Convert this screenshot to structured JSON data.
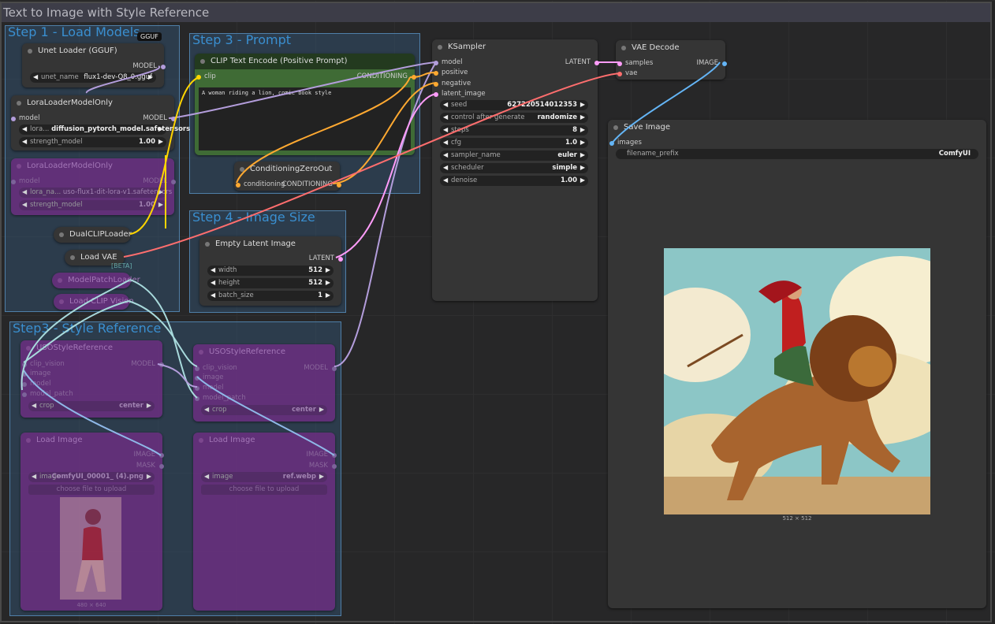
{
  "workflow_title": "Text to Image with Style Reference",
  "groups": {
    "step1": "Step 1 - Load Models",
    "step3_prompt": "Step 3 - Prompt",
    "step4": "Step 4 - Image Size",
    "step3_style": "Step3 - Style Reference"
  },
  "gguf_badge": "GGUF",
  "unet_loader": {
    "title": "Unet Loader (GGUF)",
    "out": "MODEL",
    "widget_label": "unet_name",
    "widget_value": "flux1-dev-Q8_0.gguf"
  },
  "lora_loader": {
    "title": "LoraLoaderModelOnly",
    "in_model": "model",
    "out": "MODEL",
    "lora_label": "lora...",
    "lora_value": "diffusion_pytorch_model.safetensors",
    "strength_label": "strength_model",
    "strength_value": "1.00"
  },
  "lora_loader2": {
    "title": "LoraLoaderModelOnly",
    "in_model": "model",
    "out": "MODEL",
    "lora_label": "lora_na...",
    "lora_value": "uso-flux1-dit-lora-v1.safetensors",
    "strength_label": "strength_model",
    "strength_value": "1.00"
  },
  "dual_clip": {
    "title": "DualCLIPLoader"
  },
  "load_vae": {
    "title": "Load VAE",
    "tag": "[BETA]"
  },
  "model_patch": {
    "title": "ModelPatchLoader"
  },
  "load_clip_vision": {
    "title": "Load CLIP Vision"
  },
  "clip_encode": {
    "title": "CLIP Text Encode (Positive Prompt)",
    "in_clip": "clip",
    "out": "CONDITIONING",
    "text": "A woman riding a lion, comic book style"
  },
  "cond_zero": {
    "title": "ConditioningZeroOut",
    "in": "conditioning",
    "out": "CONDITIONING"
  },
  "empty_latent": {
    "title": "Empty Latent Image",
    "out": "LATENT",
    "width_label": "width",
    "width": "512",
    "height_label": "height",
    "height": "512",
    "batch_label": "batch_size",
    "batch": "1"
  },
  "ksampler": {
    "title": "KSampler",
    "in_model": "model",
    "in_positive": "positive",
    "in_negative": "negative",
    "in_latent": "latent_image",
    "out": "LATENT",
    "widgets": [
      {
        "label": "seed",
        "value": "627220514012353"
      },
      {
        "label": "control after generate",
        "value": "randomize"
      },
      {
        "label": "steps",
        "value": "8"
      },
      {
        "label": "cfg",
        "value": "1.0"
      },
      {
        "label": "sampler_name",
        "value": "euler"
      },
      {
        "label": "scheduler",
        "value": "simple"
      },
      {
        "label": "denoise",
        "value": "1.00"
      }
    ]
  },
  "vae_decode": {
    "title": "VAE Decode",
    "in_samples": "samples",
    "in_vae": "vae",
    "out": "IMAGE"
  },
  "save_image": {
    "title": "Save Image",
    "in_images": "images",
    "prefix_label": "filename_prefix",
    "prefix_value": "ComfyUI",
    "size_caption": "512 × 512"
  },
  "uso1": {
    "title": "USOStyleReference",
    "in_clip": "clip_vision",
    "in_image": "image",
    "in_model": "model",
    "in_mode": "model_patch",
    "out": "MODEL",
    "crop_label": "crop",
    "crop_value": "center"
  },
  "uso2": {
    "title": "USOStyleReference",
    "in_clip": "clip_vision",
    "in_image": "image",
    "in_model": "model",
    "in_mode": "model_patch",
    "out": "MODEL",
    "crop_label": "crop",
    "crop_value": "center"
  },
  "load_image1": {
    "title": "Load Image",
    "out_image": "IMAGE",
    "out_mask": "MASK",
    "image_label": "image",
    "image_value": "ComfyUI_00001_ (4).png",
    "upload": "choose file to upload",
    "size_caption": "480 × 640"
  },
  "load_image2": {
    "title": "Load Image",
    "out_image": "IMAGE",
    "out_mask": "MASK",
    "image_label": "image",
    "image_value": "ref.webp",
    "upload": "choose file to upload"
  },
  "colors": {
    "model": "#b39ddb",
    "clip": "#ffd500",
    "conditioning": "#ffa931",
    "latent": "#ff9cf9",
    "vae": "#ff6e6e",
    "image": "#64b5f6",
    "clip_vision": "#a8dadc"
  }
}
